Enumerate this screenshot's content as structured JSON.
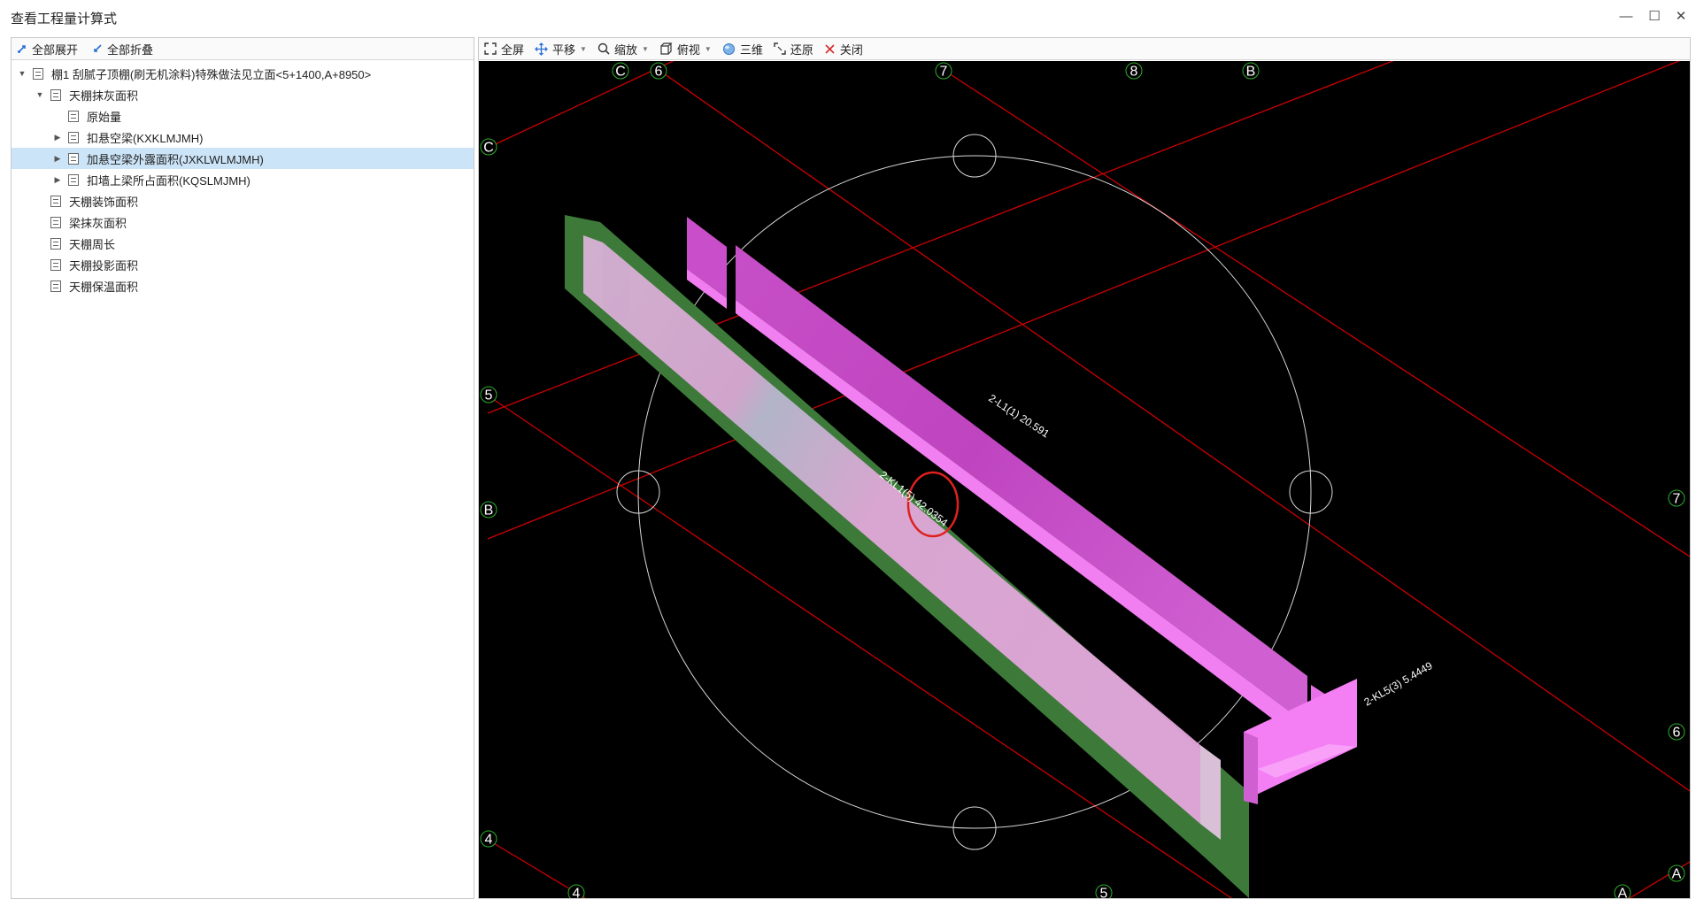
{
  "window": {
    "title": "查看工程量计算式",
    "controls": {
      "minimize": "—",
      "maximize": "☐",
      "close": "✕"
    }
  },
  "left_toolbar": {
    "expand_all": "全部展开",
    "collapse_all": "全部折叠"
  },
  "tree": {
    "root": "棚1 刮腻子顶棚(刷无机涂料)特殊做法见立面<5+1400,A+8950>",
    "items": [
      {
        "label": "天棚抹灰面积",
        "level": 1,
        "expander": "expanded"
      },
      {
        "label": "原始量",
        "level": 2,
        "expander": "none"
      },
      {
        "label": "扣悬空梁(KXKLMJMH)",
        "level": 2,
        "expander": "collapsed"
      },
      {
        "label": "加悬空梁外露面积(JXKLWLMJMH)",
        "level": 2,
        "expander": "collapsed",
        "selected": true
      },
      {
        "label": "扣墙上梁所占面积(KQSLMJMH)",
        "level": 2,
        "expander": "collapsed"
      },
      {
        "label": "天棚装饰面积",
        "level": 1,
        "expander": "none"
      },
      {
        "label": "梁抹灰面积",
        "level": 1,
        "expander": "none"
      },
      {
        "label": "天棚周长",
        "level": 1,
        "expander": "none"
      },
      {
        "label": "天棚投影面积",
        "level": 1,
        "expander": "none"
      },
      {
        "label": "天棚保温面积",
        "level": 1,
        "expander": "none"
      }
    ]
  },
  "view_toolbar": {
    "fullscreen": "全屏",
    "pan": "平移",
    "zoom": "缩放",
    "top_view": "俯视",
    "three_d": "三维",
    "restore": "还原",
    "close": "关闭"
  },
  "viewport": {
    "background": "#000000",
    "axis_color": "#cc0000",
    "axis_marker_color": "#2eae2e",
    "beam_color_magenta": "#e060e0",
    "beam_color_pink": "#e0a8d8",
    "beam_color_green": "#3d7a3a",
    "highlight_circle_color": "#e02020",
    "axis_labels": {
      "c_top": "C",
      "six_top": "6",
      "seven_top": "7",
      "eight_top": "8",
      "b_top": "B",
      "c_left": "C",
      "five_left": "5",
      "b_left": "B",
      "four_left": "4",
      "seven_right": "7",
      "six_right": "6",
      "a_right": "A",
      "four_bottom": "4",
      "five_bottom": "5",
      "a_bottom": "A"
    },
    "beam_labels": {
      "l1": "2-L1(1) 20.591",
      "kl1": "2-KL1(5) 42.0354",
      "kl5": "2-KL5(3) 5.4449"
    }
  }
}
